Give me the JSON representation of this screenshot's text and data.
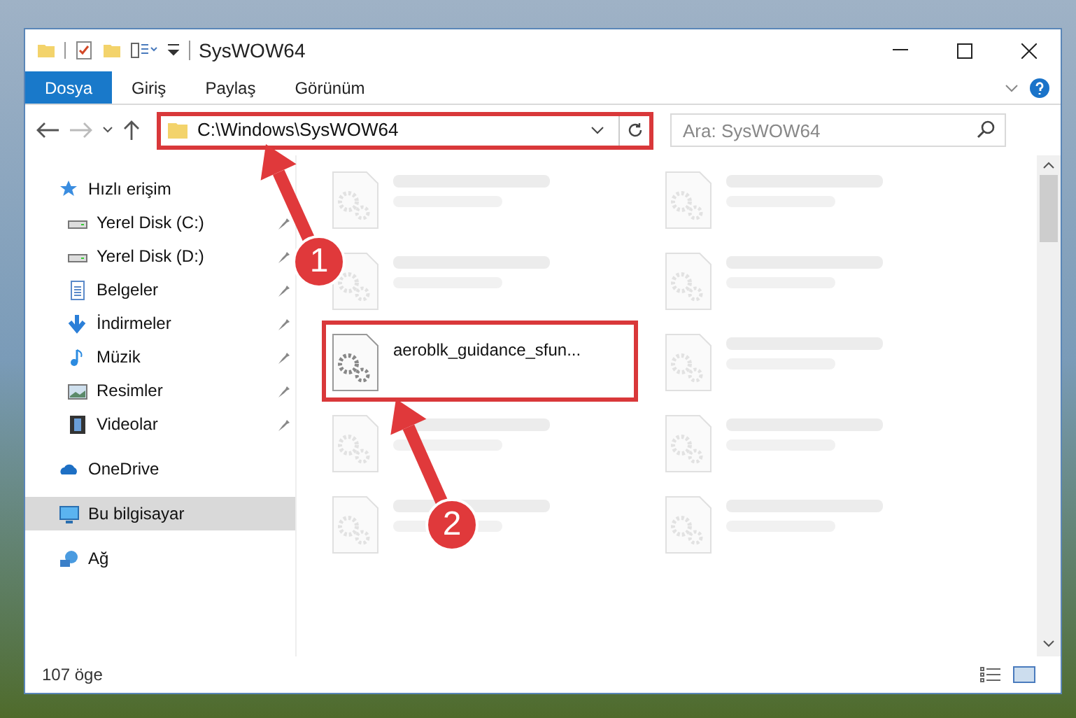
{
  "window": {
    "title": "SysWOW64"
  },
  "ribbon_tabs": [
    {
      "label": "Dosya",
      "kind": "file"
    },
    {
      "label": "Giriş",
      "kind": "tab"
    },
    {
      "label": "Paylaş",
      "kind": "tab"
    },
    {
      "label": "Görünüm",
      "kind": "tab"
    }
  ],
  "address_bar": {
    "path": "C:\\Windows\\SysWOW64",
    "highlighted": true
  },
  "search": {
    "placeholder": "Ara: SysWOW64"
  },
  "nav_pane": [
    {
      "label": "Hızlı erişim",
      "selected": false,
      "children": [
        {
          "label": "Yerel Disk (C:)",
          "pinned": true,
          "selected": false
        },
        {
          "label": "Yerel Disk (D:)",
          "pinned": true,
          "selected": false
        },
        {
          "label": "Belgeler",
          "pinned": true,
          "selected": false
        },
        {
          "label": "İndirmeler",
          "pinned": true,
          "selected": false
        },
        {
          "label": "Müzik",
          "pinned": true,
          "selected": false
        },
        {
          "label": "Resimler",
          "pinned": true,
          "selected": false
        },
        {
          "label": "Videolar",
          "pinned": true,
          "selected": false
        }
      ]
    },
    {
      "label": "OneDrive",
      "selected": false
    },
    {
      "label": "Bu bilgisayar",
      "selected": true
    },
    {
      "label": "Ağ",
      "selected": false
    }
  ],
  "files": [
    {
      "blurred": true,
      "highlighted": false
    },
    {
      "blurred": true,
      "highlighted": false
    },
    {
      "blurred": true,
      "highlighted": false
    },
    {
      "blurred": true,
      "highlighted": false
    },
    {
      "name": "aeroblk_guidance_sfun...",
      "blurred": false,
      "highlighted": true
    },
    {
      "blurred": true,
      "highlighted": false
    },
    {
      "blurred": true,
      "highlighted": false
    },
    {
      "blurred": true,
      "highlighted": false
    },
    {
      "blurred": true,
      "highlighted": false
    },
    {
      "blurred": true,
      "highlighted": false
    }
  ],
  "status_bar": {
    "item_count": "107 öge"
  },
  "annotations": [
    {
      "label": "1"
    },
    {
      "label": "2"
    }
  ]
}
